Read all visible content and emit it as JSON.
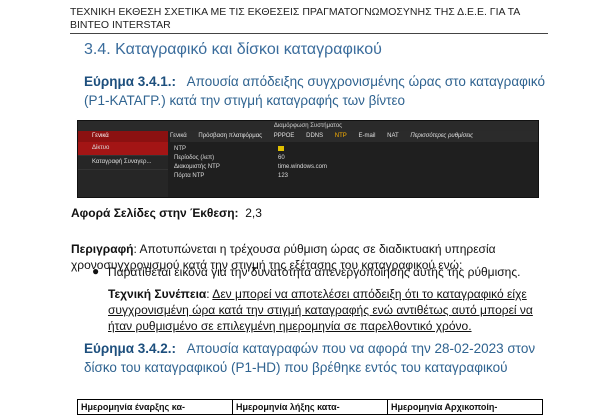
{
  "header": {
    "line1": "ΤΕΧΝΙΚΗ ΕΚΘΕΣΗ ΣΧΕΤΙΚΑ ΜΕ ΤΙΣ ΕΚΘΕΣΕΙΣ ΠΡΑΓΜΑΤΟΓΝΩΜΟΣΥΝΗΣ ΤΗΣ Δ.Ε.Ε. ΓΙΑ ΤΑ",
    "line2": "ΒΙΝΤΕΟ INTERSTAR"
  },
  "section_title": "3.4.  Καταγραφικό και δίσκοι καταγραφικού",
  "finding1": {
    "label": "Εύρημα 3.4.1.:",
    "text": "Απουσία απόδειξης συγχρονισμένης ώρας στο καταγραφικό (P1-ΚΑΤΑΓΡ.) κατά την στιγμή καταγραφής των βίντεο"
  },
  "screenshot": {
    "title": "Διαμόρφωση Συστήματος",
    "sidebar_head": "Γενικά",
    "sidebar_items": [
      "Δίκτυο",
      "Καταγραφή Συναγερ..."
    ],
    "tabs": [
      "Γενικά",
      "Πρόσβαση πλατφόρμας",
      "PPPOE",
      "DDNS",
      "NTP",
      "E-mail",
      "NAT",
      "Περισσότερες ρυθμίσεις"
    ],
    "rows": [
      {
        "label": "NTP",
        "value": ""
      },
      {
        "label": "Περίοδος (λεπ)",
        "value": "60"
      },
      {
        "label": "Διακομιστής NTP",
        "value": "time.windows.com"
      },
      {
        "label": "Πόρτα NTP",
        "value": "123"
      }
    ]
  },
  "affects": {
    "label": "Αφορά Σελίδες στην Έκθεση:",
    "value": "2,3"
  },
  "description": {
    "label": "Περιγραφή",
    "text": ": Αποτυπώνεται η τρέχουσα ρύθμιση ώρας σε διαδικτυακή υπηρεσία χρονοσυγχρονισμού κατά την στιγμή της εξέτασης του καταγραφικού ενώ:"
  },
  "bullet": "Παρατίθεται εικόνα για την δυνατότητα απενεργοποίησης αυτής της ρύθμισης.",
  "tech_note": {
    "label": "Τεχνική Συνέπεια",
    "text": "Δεν μπορεί να αποτελέσει απόδειξη ότι το καταγραφικό είχε συγχρονισμένη ώρα κατά την στιγμή καταγραφής ενώ αντιθέτως αυτό μπορεί να ήταν ρυθμισμένο σε επιλεγμένη ημερομηνία σε παρελθοντικό χρόνο."
  },
  "finding2": {
    "label": "Εύρημα 3.4.2.:",
    "text": "Απουσία καταγραφών που να αφορά την 28-02-2023 στον δίσκο του καταγραφικού (P1-HD) που βρέθηκε εντός του καταγραφικού"
  },
  "table_headers": [
    "Ημερομηνία έναρξης κα-",
    "Ημερομηνία λήξης κατα-",
    "Ημερομηνία Αρχικοποίη-"
  ]
}
